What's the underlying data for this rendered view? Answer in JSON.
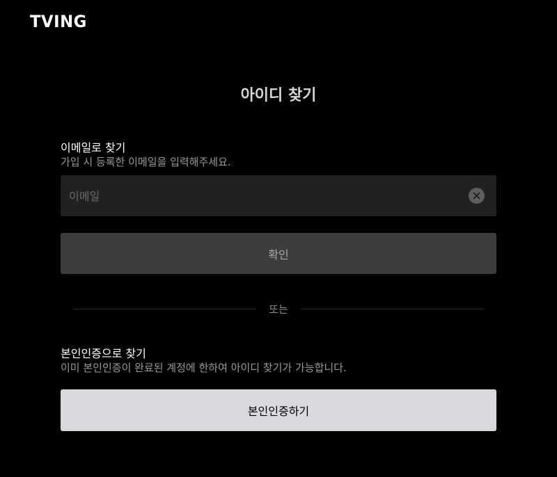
{
  "header": {
    "logo": "TVING"
  },
  "page": {
    "title": "아이디 찾기"
  },
  "email_section": {
    "title": "이메일로 찾기",
    "description": "가입 시 등록한 이메일을 입력해주세요.",
    "input_value": "",
    "input_placeholder": "이메일",
    "confirm_label": "확인"
  },
  "divider": {
    "label": "또는"
  },
  "identity_section": {
    "title": "본인인증으로 찾기",
    "description": "이미 본인인증이 완료된 계정에 한하여 아이디 찾기가 가능합니다.",
    "button_label": "본인인증하기"
  },
  "footer": {
    "partial_text": ""
  },
  "colors": {
    "background": "#000000",
    "input_bg": "#212121",
    "confirm_bg": "#3d3d3d",
    "verify_bg": "#d9d8dc"
  }
}
